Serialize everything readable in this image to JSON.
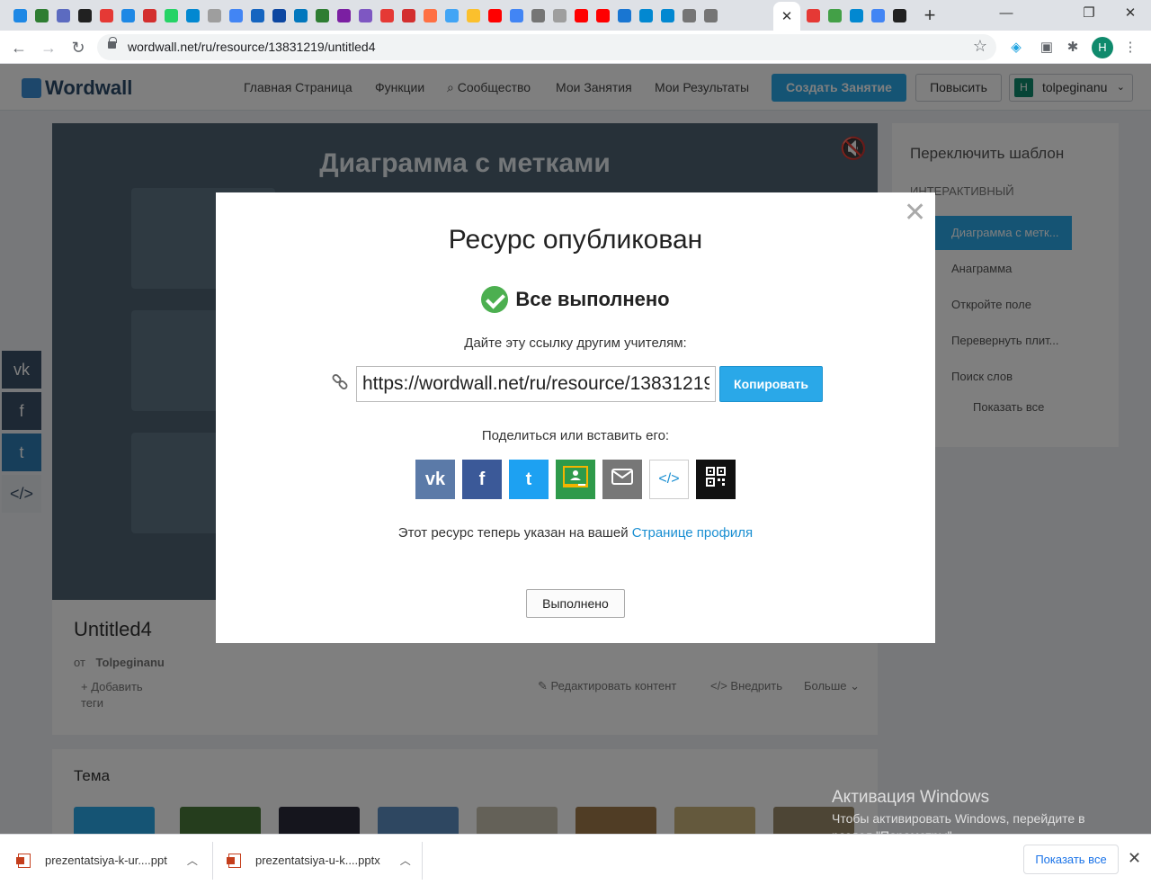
{
  "browser": {
    "url": "wordwall.net/ru/resource/13831219/untitled4",
    "active_tab_close": "✕",
    "new_tab": "+",
    "profile_initial": "H",
    "tab_favicon_colors": [
      "#1e88e5",
      "#2e7d32",
      "#5c6bc0",
      "#212121",
      "#e53935",
      "#1e88e5",
      "#d32f2f",
      "#25d366",
      "#0288d1",
      "#9e9e9e",
      "#4285f4",
      "#1565c0",
      "#0d47a1",
      "#0277bd",
      "#2e7d32",
      "#7b1fa2",
      "#7e57c2",
      "#e53935",
      "#d32f2f",
      "#ff7043",
      "#42a5f5",
      "#fbc02d",
      "#ff0000",
      "#4285f4",
      "#757575",
      "#9e9e9e",
      "#ff0000",
      "#ff0000",
      "#1976d2",
      "#0288d1",
      "#0288d1",
      "#757575",
      "#757575"
    ],
    "right_tab_favicon_colors": [
      "#e53935",
      "#43a047",
      "#0288d1",
      "#4285f4",
      "#212121"
    ]
  },
  "wordwall": {
    "logo": "Wordwall",
    "nav": [
      "Главная Страница",
      "Функции",
      "Сообщество",
      "Мои Занятия",
      "Мои Результаты"
    ],
    "create_button": "Создать Занятие",
    "upgrade_button": "Повысить",
    "user_initial": "H",
    "username": "tolpeginanu",
    "activity_title": "Диаграмма с метками",
    "switch_template": {
      "title": "Переключить шаблон",
      "section": "ИНТЕРАКТИВНЫЙ",
      "items": [
        "Диаграмма с метк...",
        "Анаграмма",
        "Откройте поле",
        "Перевернуть плит...",
        "Поиск слов"
      ],
      "show_all": "Показать все"
    },
    "resource_title": "Untitled4",
    "author_prefix": "от",
    "author": "Tolpeginanu",
    "add_tags": "Добавить теги",
    "actions": [
      "Редактировать контент",
      "Внедрить",
      "Больше"
    ],
    "theme_title": "Тема"
  },
  "modal": {
    "title": "Ресурс опубликован",
    "status": "Все выполнено",
    "share_prompt": "Дайте эту ссылку другим учителям:",
    "link_value": "https://wordwall.net/ru/resource/13831219",
    "copy_button": "Копировать",
    "share_label": "Поделиться или вставить его:",
    "share_buttons": [
      {
        "name": "vk",
        "color": "#5b7aa8",
        "glyph": "vk"
      },
      {
        "name": "facebook",
        "color": "#3b5998",
        "glyph": "f"
      },
      {
        "name": "twitter",
        "color": "#1da1f2",
        "glyph": "t"
      },
      {
        "name": "google-classroom",
        "color": "#2e9a4a",
        "glyph": ""
      },
      {
        "name": "email",
        "color": "#777777",
        "glyph": "✉"
      },
      {
        "name": "embed",
        "color": "#ffffff",
        "glyph": "</>"
      },
      {
        "name": "qr-code",
        "color": "#111111",
        "glyph": ""
      }
    ],
    "profile_note": "Этот ресурс теперь указан на вашей",
    "profile_link": "Странице профиля",
    "done_button": "Выполнено",
    "close": "✕"
  },
  "windows_activation": {
    "title": "Активация Windows",
    "text": "Чтобы активировать Windows, перейдите в раздел \"Параметры\"."
  },
  "downloads": {
    "items": [
      "prezentatsiya-k-ur....ppt",
      "prezentatsiya-u-k....pptx"
    ],
    "show_all": "Показать все",
    "close": "✕"
  }
}
